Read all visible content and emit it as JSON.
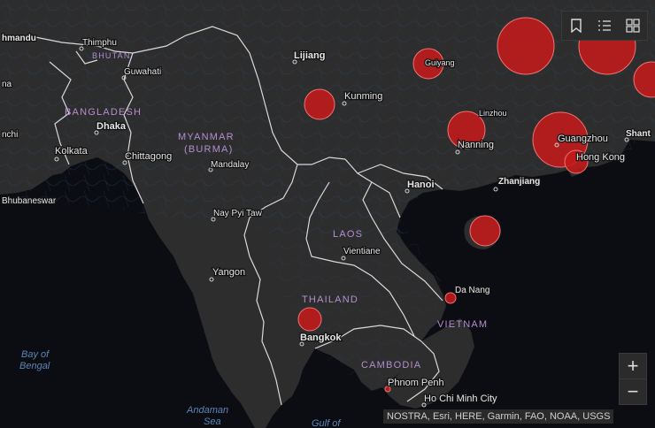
{
  "map": {
    "attribution": "NOSTRA, Esri, HERE, Garmin, FAO, NOAA, USGS",
    "country_labels": [
      "BHUTAN",
      "BANGLADESH",
      "MYANMAR",
      "(BURMA)",
      "LAOS",
      "THAILAND",
      "VIETNAM",
      "CAMBODIA"
    ],
    "city_labels": [
      "Thimphu",
      "Guwahati",
      "Lijiang",
      "Kunming",
      "Dhaka",
      "Kolkata",
      "Chittagong",
      "Mandalay",
      "Nay Pyi Taw",
      "Yangon",
      "Hanoi",
      "Vientiane",
      "Bangkok",
      "Da Nang",
      "Phnom Penh",
      "Ho Chi Minh City",
      "Nanning",
      "Guangzhou",
      "Hong Kong",
      "Zhanjiang",
      "Guiyang",
      "Linzhou"
    ],
    "edge_labels": [
      "hmandu",
      "na",
      "nchi",
      "Bhubaneswar",
      "Shant"
    ],
    "water_labels": [
      "Bay of",
      "Bengal",
      "Andaman",
      "Sea",
      "Gulf of"
    ],
    "colors": {
      "water": "#0b0d12",
      "land": "#2d2d2d",
      "border": "#d9d9d9",
      "country_label": "#b48fcf",
      "city_label": "#e6e6e6",
      "water_label": "#5b86b8",
      "bubble_fill": "#c41a1a",
      "bubble_stroke": "#f07474"
    },
    "case_bubbles": [
      {
        "place": "Guiyang",
        "size": "medium"
      },
      {
        "place": "Hunan",
        "size": "large"
      },
      {
        "place": "Jiangxi",
        "size": "large"
      },
      {
        "place": "Fujian",
        "size": "medium"
      },
      {
        "place": "Yunnan",
        "size": "medium"
      },
      {
        "place": "Guangxi",
        "size": "medium"
      },
      {
        "place": "Guangdong",
        "size": "large"
      },
      {
        "place": "Hong Kong",
        "size": "small"
      },
      {
        "place": "Hainan",
        "size": "medium"
      },
      {
        "place": "Da Nang",
        "size": "tiny"
      },
      {
        "place": "Bangkok",
        "size": "small"
      },
      {
        "place": "Phnom Penh",
        "size": "dot"
      }
    ]
  },
  "toolbar": [
    {
      "name": "bookmark-icon"
    },
    {
      "name": "legend-list-icon"
    },
    {
      "name": "basemap-gallery-icon"
    }
  ],
  "zoom": {
    "in_label": "+",
    "out_label": "−"
  }
}
